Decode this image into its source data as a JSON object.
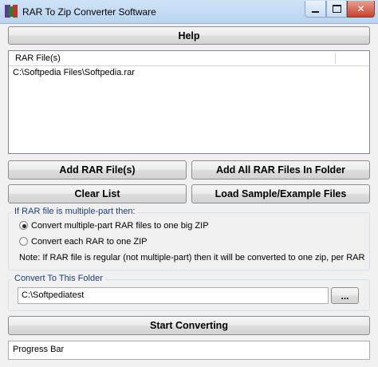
{
  "window": {
    "title": "RAR To Zip Converter Software",
    "minimize_glyph": "",
    "close_glyph": "✕"
  },
  "buttons": {
    "help": "Help",
    "add_rar": "Add RAR File(s)",
    "add_all_rar": "Add All RAR Files In Folder",
    "clear_list": "Clear List",
    "load_sample": "Load Sample/Example Files",
    "browse": "...",
    "start": "Start Converting"
  },
  "file_list": {
    "header": "RAR File(s)",
    "rows": [
      "C:\\Softpedia Files\\Softpedia.rar"
    ]
  },
  "multipart_group": {
    "label": "If RAR file is multiple-part then:",
    "options": [
      {
        "label": "Convert multiple-part RAR files to one big ZIP",
        "selected": true
      },
      {
        "label": "Convert each RAR to one ZIP",
        "selected": false
      }
    ],
    "note": "Note: If RAR file is regular (not multiple-part) then it will be converted to one zip, per RAR"
  },
  "output_group": {
    "label": "Convert To This Folder",
    "folder": "C:\\Softpediatest"
  },
  "progress": {
    "label": "Progress Bar"
  }
}
